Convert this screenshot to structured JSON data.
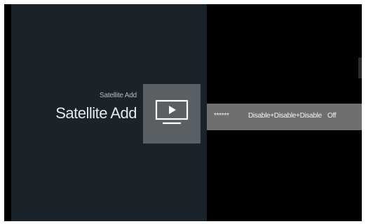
{
  "header": {
    "breadcrumb": "Satellite Add",
    "title": "Satellite Add"
  },
  "tile": {
    "icon": "tv-play-icon"
  },
  "row": {
    "name": "******",
    "mode": "Disable+Disable+Disable",
    "status": "Off"
  }
}
